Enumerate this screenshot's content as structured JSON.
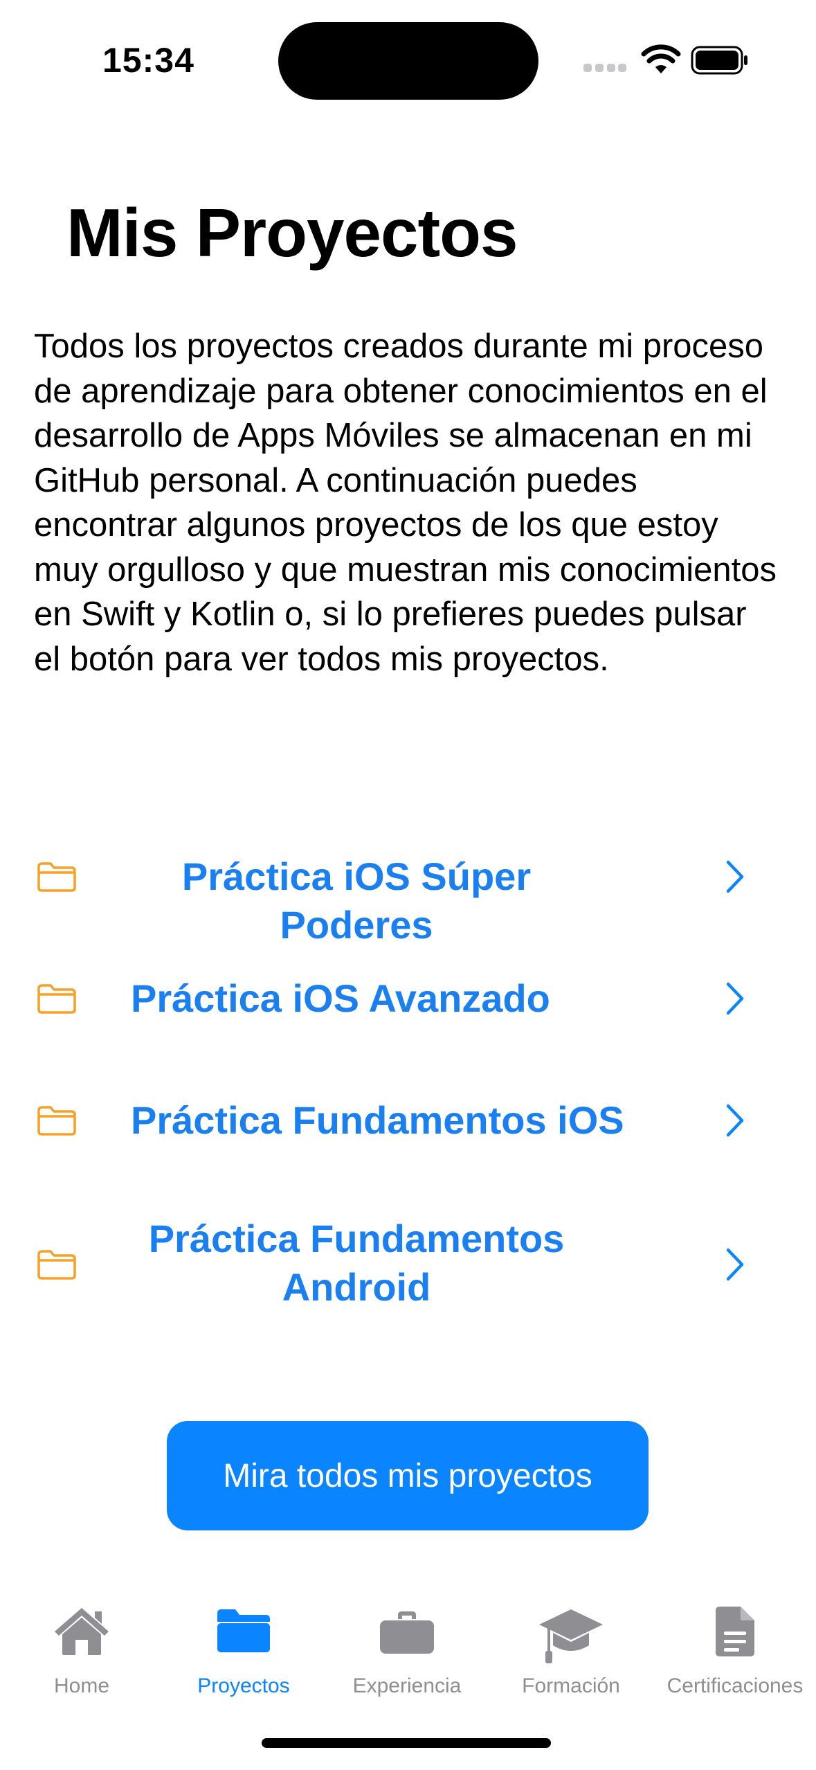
{
  "status_bar": {
    "time": "15:34"
  },
  "header": {
    "title": "Mis Proyectos"
  },
  "intro": {
    "text": "Todos los proyectos creados durante mi proceso de aprendizaje para obtener conocimientos en el desarrollo de Apps Móviles se almacenan en mi GitHub personal. A continuación puedes encontrar algunos proyectos de los que estoy muy orgulloso y que muestran mis conocimientos en Swift y Kotlin o, si lo prefieres puedes pulsar el botón para ver todos mis proyectos."
  },
  "projects": [
    {
      "label": "Práctica iOS Súper Poderes"
    },
    {
      "label": "Práctica iOS Avanzado"
    },
    {
      "label": "Práctica Fundamentos iOS"
    },
    {
      "label": "Práctica Fundamentos Android"
    }
  ],
  "cta": {
    "label": "Mira todos mis proyectos"
  },
  "tabs": [
    {
      "label": "Home",
      "icon": "house-icon"
    },
    {
      "label": "Proyectos",
      "icon": "folder-icon"
    },
    {
      "label": "Experiencia",
      "icon": "briefcase-icon"
    },
    {
      "label": "Formación",
      "icon": "graduation-cap-icon"
    },
    {
      "label": "Certificaciones",
      "icon": "document-icon"
    }
  ],
  "selected_tab": "Proyectos",
  "colors": {
    "accent": "#0a84ff",
    "link": "#1a7ff1",
    "folder": "#f7a024",
    "inactive_tab": "#8e8e93"
  }
}
